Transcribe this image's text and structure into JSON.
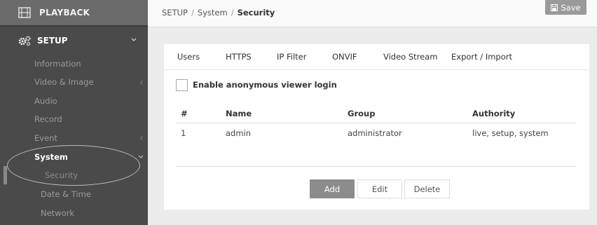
{
  "sidebar": {
    "playback_label": "PLAYBACK",
    "setup_label": "SETUP",
    "items": [
      {
        "label": "Information"
      },
      {
        "label": "Video & Image"
      },
      {
        "label": "Audio"
      },
      {
        "label": "Record"
      },
      {
        "label": "Event"
      },
      {
        "label": "System"
      },
      {
        "label": "Security"
      },
      {
        "label": "Date & Time"
      },
      {
        "label": "Network"
      }
    ]
  },
  "header": {
    "breadcrumb": [
      "SETUP",
      "System",
      "Security"
    ],
    "breadcrumb_sep": "/",
    "save_label": "Save"
  },
  "tabs": [
    {
      "label": "Users"
    },
    {
      "label": "HTTPS"
    },
    {
      "label": "IP Filter"
    },
    {
      "label": "ONVIF"
    },
    {
      "label": "Video Stream"
    },
    {
      "label": "Export / Import"
    }
  ],
  "anonymous_login": {
    "label": "Enable anonymous viewer login",
    "checked": false
  },
  "table": {
    "columns": [
      "#",
      "Name",
      "Group",
      "Authority"
    ],
    "rows": [
      [
        "1",
        "admin",
        "administrator",
        "live, setup, system"
      ]
    ]
  },
  "buttons": {
    "add": "Add",
    "edit": "Edit",
    "delete": "Delete"
  },
  "colors": {
    "sidebar": "#4a4a4a",
    "accent_button": "#8c8c8c"
  }
}
